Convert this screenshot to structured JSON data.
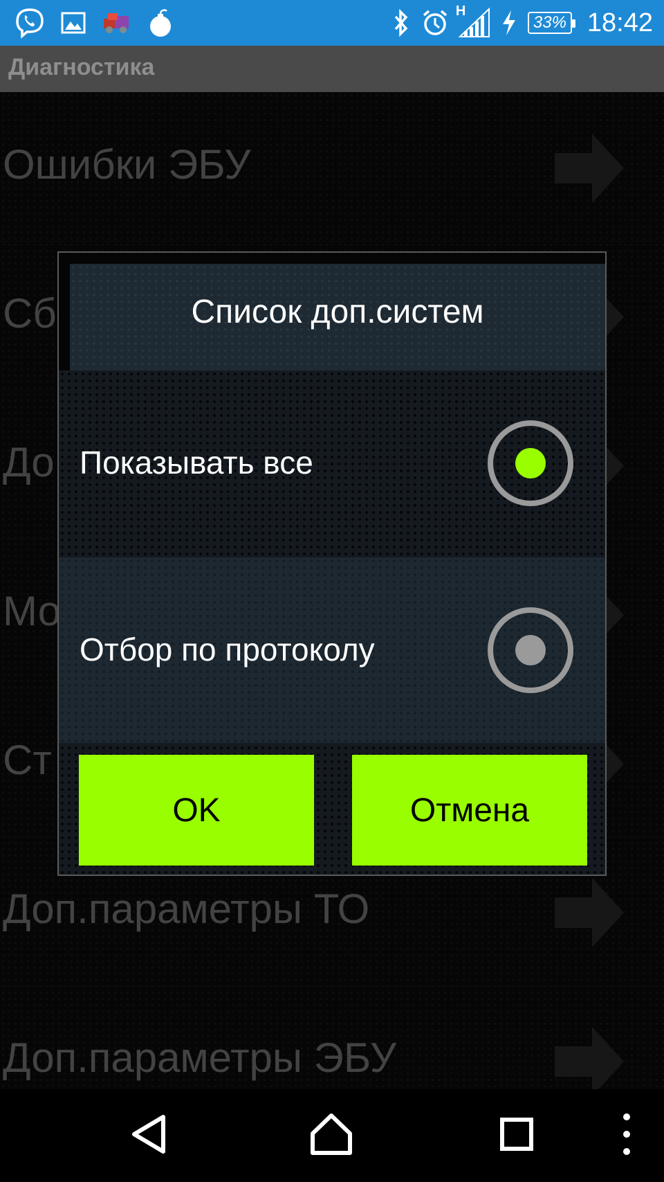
{
  "status_bar": {
    "left_icons": [
      "viber-icon",
      "gallery-icon",
      "car-app-icon",
      "bomb-icon"
    ],
    "right_icons": [
      "bluetooth-icon",
      "alarm-icon",
      "signal-icon",
      "charging-icon"
    ],
    "network_type": "H",
    "battery": "33%",
    "time": "18:42",
    "color": "#1e8ad6"
  },
  "app_bar": {
    "title": "Диагностика"
  },
  "list": {
    "items": [
      {
        "label": "Ошибки ЭБУ"
      },
      {
        "label": "Сб"
      },
      {
        "label": "До"
      },
      {
        "label": "Мо"
      },
      {
        "label": "Ст"
      },
      {
        "label": "Доп.параметры ТО"
      },
      {
        "label": "Доп.параметры ЭБУ"
      }
    ]
  },
  "dialog": {
    "title": "Список доп.систем",
    "options": [
      {
        "label": "Показывать все",
        "selected": true
      },
      {
        "label": "Отбор по протоколу",
        "selected": false
      }
    ],
    "ok_label": "OK",
    "cancel_label": "Отмена",
    "accent_color": "#99ff00"
  },
  "nav_bar": {
    "buttons": [
      "back-icon",
      "home-icon",
      "recents-icon",
      "overflow-menu-icon"
    ]
  }
}
